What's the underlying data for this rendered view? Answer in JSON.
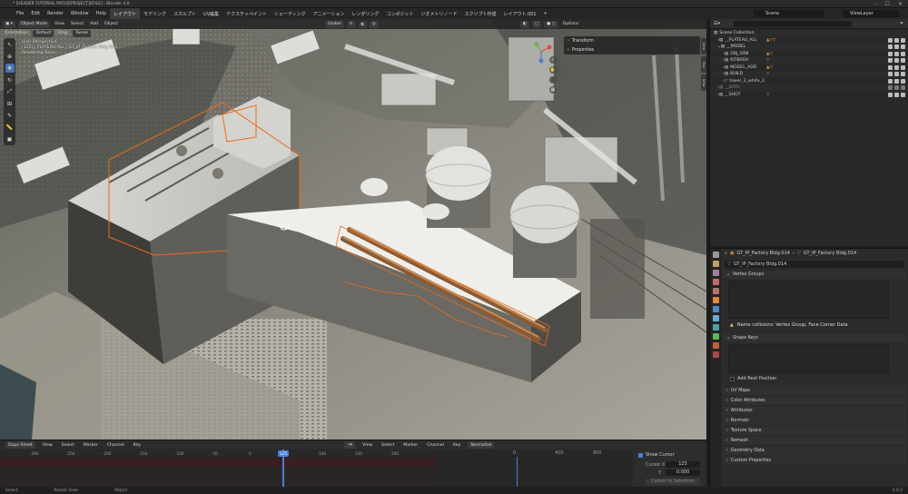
{
  "window": {
    "title": "* [HEADER TUTORIAL PATH]/[PROJECT]/[FILE] - Blender 4.0"
  },
  "menu": {
    "items": [
      "File",
      "Edit",
      "Render",
      "Window",
      "Help"
    ],
    "tabs": [
      "レイアウト",
      "モデリング",
      "スカルプト",
      "UV編集",
      "テクスチャペイント",
      "シェーディング",
      "アニメーション",
      "レンダリング",
      "コンポジット",
      "ジオメトリノード",
      "スクリプト作成",
      "レイアウト.001"
    ],
    "active_tab": "レイアウト",
    "add": "+"
  },
  "scene": {
    "label": "Scene",
    "layer": "ViewLayer"
  },
  "viewport": {
    "mode": "Object Mode",
    "view": "View",
    "select": "Select",
    "add": "Add",
    "object": "Object",
    "orientation": "Global",
    "orientation_label": "Orientation:",
    "default": "Default",
    "drag": "Drag:",
    "tweak": "Tweak",
    "options": "Options",
    "overlay": {
      "line1": "User Perspective",
      "line2": "(125) | PLATEAU ALL | GT_IP_Factory Bldg.014",
      "line3": "Rendering Done"
    }
  },
  "npanel": {
    "transform": "Transform",
    "properties": "Properties",
    "tabs": [
      "Item",
      "Tool",
      "View"
    ]
  },
  "outliner": {
    "title": "Scene Collection",
    "rows": [
      {
        "label": "Scene Collection",
        "indent": 0
      },
      {
        "label": "__PLATEAU_ALL",
        "indent": 1
      },
      {
        "label": "__MODEL",
        "indent": 1
      },
      {
        "label": "OBJ_ORB",
        "indent": 2
      },
      {
        "label": "KITBASH",
        "indent": 2
      },
      {
        "label": "MODEL_ADD",
        "indent": 2
      },
      {
        "label": "BUILD",
        "indent": 2
      },
      {
        "label": "tower_2_white_3",
        "indent": 2
      },
      {
        "label": "__DATA",
        "indent": 1
      },
      {
        "label": "__SHOT",
        "indent": 1
      }
    ]
  },
  "properties": {
    "object_path": "GT_IP_Factory Bldg.014",
    "mesh_name": "GT_IP_Factory Bldg.014",
    "sections": [
      "Vertex Groups",
      "Shape Keys",
      "UV Maps",
      "Color Attributes",
      "Attributes",
      "Normals",
      "Texture Space",
      "Remesh",
      "Geometry Data",
      "Custom Properties"
    ],
    "warning": "Name collisions: Vertex Group, Face Corner Data",
    "add_rest": "Add Rest Position"
  },
  "timeline": {
    "mode": "Dope Sheet",
    "menus": [
      "View",
      "Select",
      "Marker",
      "Channel",
      "Key"
    ],
    "ruler": [
      "-300",
      "-250",
      "-200",
      "-150",
      "-100",
      "-50",
      "0",
      "50",
      "100",
      "150",
      "200"
    ],
    "current_frame": "125",
    "graph_menus": [
      "View",
      "Select",
      "Marker",
      "Channel",
      "Key"
    ],
    "normalize": "Normalize",
    "graph_ruler": [
      "0",
      "400",
      "800"
    ],
    "show_cursor": "Show Cursor",
    "cursor_x_label": "Cursor X",
    "cursor_x": "125",
    "cursor_y_label": "Y",
    "cursor_y": "0.000",
    "cursor_to_selection": "Cursor to Selection"
  },
  "status": {
    "left": "Select",
    "mid": "Rotate View",
    "right": "Object",
    "version": "4.0.2"
  }
}
